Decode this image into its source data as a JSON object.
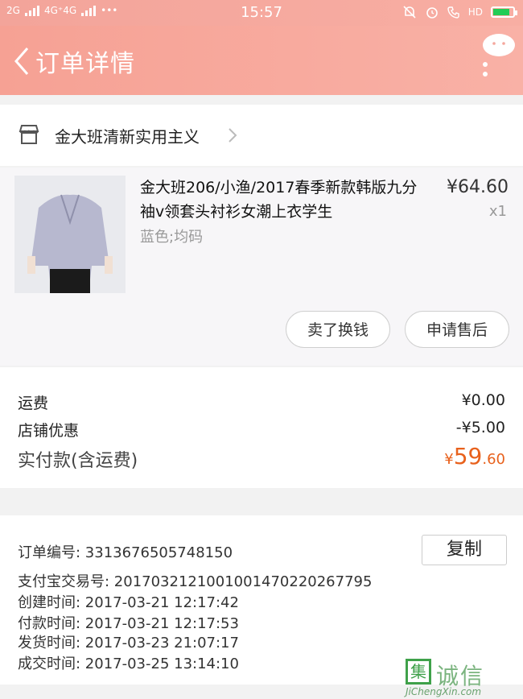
{
  "status_bar": {
    "network_left": "2G",
    "network_mid": "4G⁺4G",
    "more": "•••",
    "time": "15:57",
    "hd": "HD",
    "battery_level": 0.85
  },
  "header": {
    "title": "订单详情"
  },
  "shop": {
    "name": "金大班清新实用主义"
  },
  "product": {
    "title": "金大班206/小渔/2017春季新款韩版九分袖v领套头衬衫女潮上衣学生",
    "sku": "蓝色;均码",
    "price": "¥64.60",
    "qty": "x1",
    "buttons": {
      "sell": "卖了换钱",
      "after_sale": "申请售后"
    }
  },
  "fees": {
    "shipping_label": "运费",
    "shipping_value": "¥0.00",
    "discount_label": "店铺优惠",
    "discount_value": "-¥5.00",
    "paid_label": "实付款(含运费)",
    "paid_currency": "¥",
    "paid_int": "59",
    "paid_dec": ".60"
  },
  "order_info": {
    "order_no": "订单编号:   3313676505748150",
    "copy": "复制",
    "alipay_no": "支付宝交易号:   2017032121001001470220267795",
    "created": "创建时间:   2017-03-21  12:17:42",
    "paid": "付款时间:   2017-03-21  12:17:53",
    "shipped": "发货时间:   2017-03-23  21:07:17",
    "completed": "成交时间:   2017-03-25  13:14:10"
  },
  "watermark": {
    "mark": "集",
    "text": "诚信",
    "url": "JiChengXin.com"
  }
}
